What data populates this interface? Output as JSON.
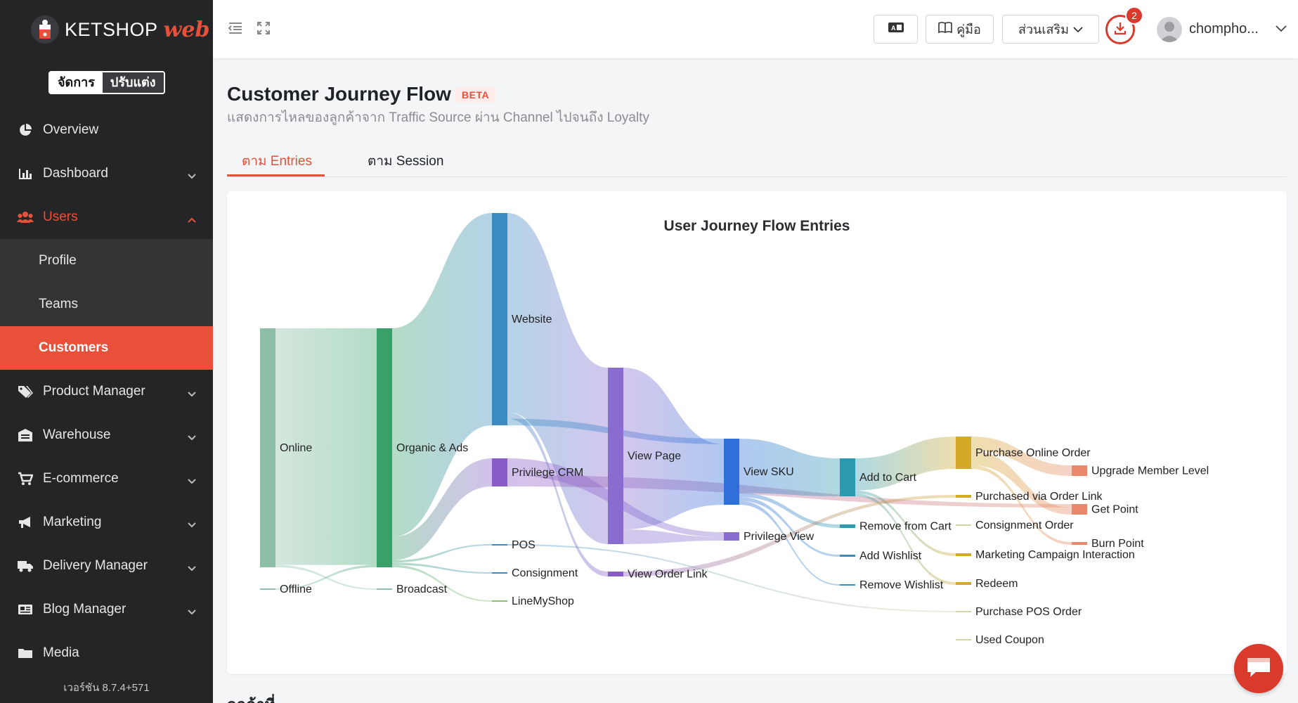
{
  "brand": {
    "name": "KETSHOP",
    "suffix": "web"
  },
  "mode_switch": {
    "manage": "จัดการ",
    "customize": "ปรับแต่ง"
  },
  "sidebar": {
    "items": [
      {
        "label": "Overview",
        "icon": "pie-chart-icon"
      },
      {
        "label": "Dashboard",
        "icon": "bar-chart-icon"
      },
      {
        "label": "Users",
        "icon": "users-icon"
      },
      {
        "label": "Product Manager",
        "icon": "tags-icon"
      },
      {
        "label": "Warehouse",
        "icon": "warehouse-icon"
      },
      {
        "label": "E-commerce",
        "icon": "cart-icon"
      },
      {
        "label": "Marketing",
        "icon": "megaphone-icon"
      },
      {
        "label": "Delivery Manager",
        "icon": "truck-icon"
      },
      {
        "label": "Blog Manager",
        "icon": "newspaper-icon"
      },
      {
        "label": "Media",
        "icon": "folder-icon"
      }
    ],
    "sub_items": [
      {
        "label": "Profile"
      },
      {
        "label": "Teams"
      },
      {
        "label": "Customers"
      }
    ],
    "version": "เวอร์ชัน 8.7.4+571"
  },
  "topbar": {
    "manual_label": "คู่มือ",
    "addons_label": "ส่วนเสริม",
    "download_count": "2",
    "username": "chompho..."
  },
  "page": {
    "title": "Customer Journey Flow",
    "badge": "BETA",
    "subtitle": "แสดงการไหลของลูกค้าจาก Traffic Source ผ่าน Channel ไปจนถึง Loyalty",
    "tabs": [
      "ตาม Entries",
      "ตาม Session"
    ],
    "below_heading": "ลูกค้าที่..."
  },
  "chart_data": {
    "type": "sankey",
    "title": "User Journey Flow Entries",
    "nodes": [
      {
        "name": "Online",
        "color": "#8dbfa8"
      },
      {
        "name": "Offline",
        "color": "#8dbfa8"
      },
      {
        "name": "Organic & Ads",
        "color": "#3aa06a"
      },
      {
        "name": "Broadcast",
        "color": "#8dbfa8"
      },
      {
        "name": "Website",
        "color": "#3b8bc2"
      },
      {
        "name": "Privilege CRM",
        "color": "#8a5cc9"
      },
      {
        "name": "POS",
        "color": "#3b8bc2"
      },
      {
        "name": "Consignment",
        "color": "#3b8bc2"
      },
      {
        "name": "LineMyShop",
        "color": "#8dbf6a"
      },
      {
        "name": "View Page",
        "color": "#8a6cd0"
      },
      {
        "name": "View Order Link",
        "color": "#8a5cc9"
      },
      {
        "name": "View SKU",
        "color": "#2f6fd9"
      },
      {
        "name": "Privilege View",
        "color": "#8a6cd0"
      },
      {
        "name": "Add to Cart",
        "color": "#2b9ab0"
      },
      {
        "name": "Remove from Cart",
        "color": "#2b9ab0"
      },
      {
        "name": "Add Wishlist",
        "color": "#3b8bc2"
      },
      {
        "name": "Remove Wishlist",
        "color": "#3b8bc2"
      },
      {
        "name": "Purchase Online Order",
        "color": "#d4a92a"
      },
      {
        "name": "Purchased via Order Link",
        "color": "#d4a92a"
      },
      {
        "name": "Consignment Order",
        "color": "#d4d4a0"
      },
      {
        "name": "Marketing Campaign Interaction",
        "color": "#d4a92a"
      },
      {
        "name": "Redeem",
        "color": "#d4a92a"
      },
      {
        "name": "Purchase POS Order",
        "color": "#d4d4a0"
      },
      {
        "name": "Used Coupon",
        "color": "#d4d4a0"
      },
      {
        "name": "Upgrade Member Level",
        "color": "#e8876a"
      },
      {
        "name": "Get Point",
        "color": "#e8876a"
      },
      {
        "name": "Burn Point",
        "color": "#e8876a"
      }
    ],
    "links": [
      {
        "source": "Online",
        "target": "Organic & Ads",
        "value": 100
      },
      {
        "source": "Online",
        "target": "Broadcast",
        "value": 1
      },
      {
        "source": "Offline",
        "target": "Organic & Ads",
        "value": 1
      },
      {
        "source": "Organic & Ads",
        "target": "Website",
        "value": 89
      },
      {
        "source": "Organic & Ads",
        "target": "Privilege CRM",
        "value": 10
      },
      {
        "source": "Organic & Ads",
        "target": "POS",
        "value": 1
      },
      {
        "source": "Organic & Ads",
        "target": "Consignment",
        "value": 1
      },
      {
        "source": "Organic & Ads",
        "target": "LineMyShop",
        "value": 1
      },
      {
        "source": "Website",
        "target": "View Page",
        "value": 60
      },
      {
        "source": "Website",
        "target": "View Order Link",
        "value": 2
      },
      {
        "source": "Website",
        "target": "View SKU",
        "value": 2
      },
      {
        "source": "Privilege CRM",
        "target": "Privilege View",
        "value": 3
      },
      {
        "source": "Privilege CRM",
        "target": "Get Point",
        "value": 2
      },
      {
        "source": "View Page",
        "target": "View SKU",
        "value": 22
      },
      {
        "source": "View Page",
        "target": "Privilege View",
        "value": 2
      },
      {
        "source": "View SKU",
        "target": "Add to Cart",
        "value": 14
      },
      {
        "source": "View SKU",
        "target": "Remove from Cart",
        "value": 1
      },
      {
        "source": "View SKU",
        "target": "Add Wishlist",
        "value": 1
      },
      {
        "source": "View SKU",
        "target": "Remove Wishlist",
        "value": 1
      },
      {
        "source": "Add to Cart",
        "target": "Purchase Online Order",
        "value": 11
      },
      {
        "source": "Add to Cart",
        "target": "Marketing Campaign Interaction",
        "value": 1
      },
      {
        "source": "Add to Cart",
        "target": "Redeem",
        "value": 1
      },
      {
        "source": "View Order Link",
        "target": "Purchased via Order Link",
        "value": 1
      },
      {
        "source": "POS",
        "target": "Purchase POS Order",
        "value": 1
      },
      {
        "source": "Purchase Online Order",
        "target": "Upgrade Member Level",
        "value": 4
      },
      {
        "source": "Purchase Online Order",
        "target": "Get Point",
        "value": 4
      },
      {
        "source": "Purchase Online Order",
        "target": "Burn Point",
        "value": 1
      }
    ]
  }
}
